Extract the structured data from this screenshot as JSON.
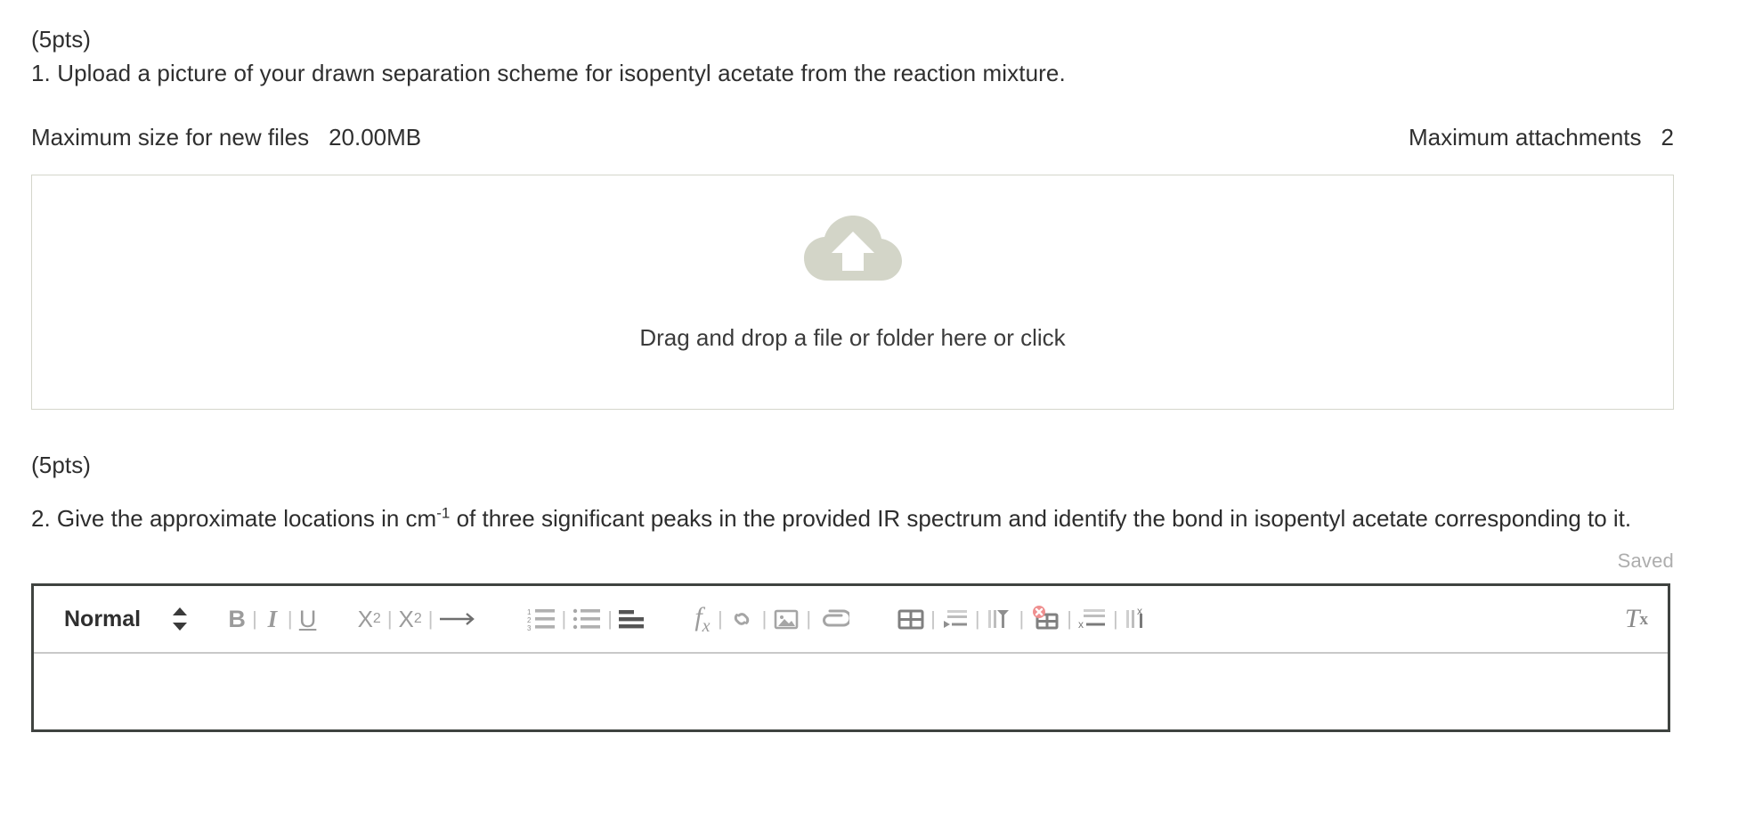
{
  "question1": {
    "points": "(5pts)",
    "prompt": "1. Upload a picture of your drawn separation scheme for isopentyl acetate from the reaction mixture."
  },
  "attachment_meta": {
    "max_size_label": "Maximum size for new files",
    "max_size_value": "20.00MB",
    "max_attachments_label": "Maximum attachments",
    "max_attachments_value": "2"
  },
  "dropzone": {
    "icon": "cloud-upload-icon",
    "text": "Drag and drop a file or folder here or click",
    "border_color": "#d4d6cb",
    "icon_color": "#d3d5c8"
  },
  "question2": {
    "points": "(5pts)",
    "prompt_part1": "2. Give the approximate locations in cm",
    "prompt_superscript": "-1",
    "prompt_part2": " of three significant peaks in the provided IR spectrum and identify the bond in isopentyl acetate corresponding to it."
  },
  "editor": {
    "status": "Saved",
    "status_color": "#adadad",
    "border_color": "#3f4340",
    "body_value": "",
    "body_placeholder": "",
    "toolbar": {
      "style_select": {
        "value": "Normal",
        "icon": "chevron-updown-icon"
      },
      "buttons": [
        {
          "name": "bold-button",
          "label": "B"
        },
        {
          "name": "italic-button",
          "label": "I"
        },
        {
          "name": "underline-button",
          "label": "U"
        },
        {
          "name": "subscript-button",
          "label": "X2"
        },
        {
          "name": "superscript-button",
          "label": "X2"
        },
        {
          "name": "text-direction-button",
          "label": "arrow-right-icon"
        },
        {
          "name": "numbered-list-button",
          "label": "numbered-list-icon"
        },
        {
          "name": "bulleted-list-button",
          "label": "bulleted-list-icon"
        },
        {
          "name": "align-button",
          "label": "align-left-icon"
        },
        {
          "name": "equation-button",
          "label": "fx"
        },
        {
          "name": "link-button",
          "label": "link-icon"
        },
        {
          "name": "image-button",
          "label": "image-icon"
        },
        {
          "name": "attachment-button",
          "label": "paperclip-icon"
        },
        {
          "name": "insert-table-button",
          "label": "table-icon"
        },
        {
          "name": "insert-row-button",
          "label": "insert-row-icon"
        },
        {
          "name": "insert-column-button",
          "label": "insert-column-icon"
        },
        {
          "name": "delete-table-button",
          "label": "delete-table-icon"
        },
        {
          "name": "delete-row-button",
          "label": "delete-row-icon"
        },
        {
          "name": "delete-column-button",
          "label": "delete-column-icon"
        },
        {
          "name": "clear-formatting-button",
          "label": "Tx"
        }
      ],
      "separator": "|"
    }
  }
}
